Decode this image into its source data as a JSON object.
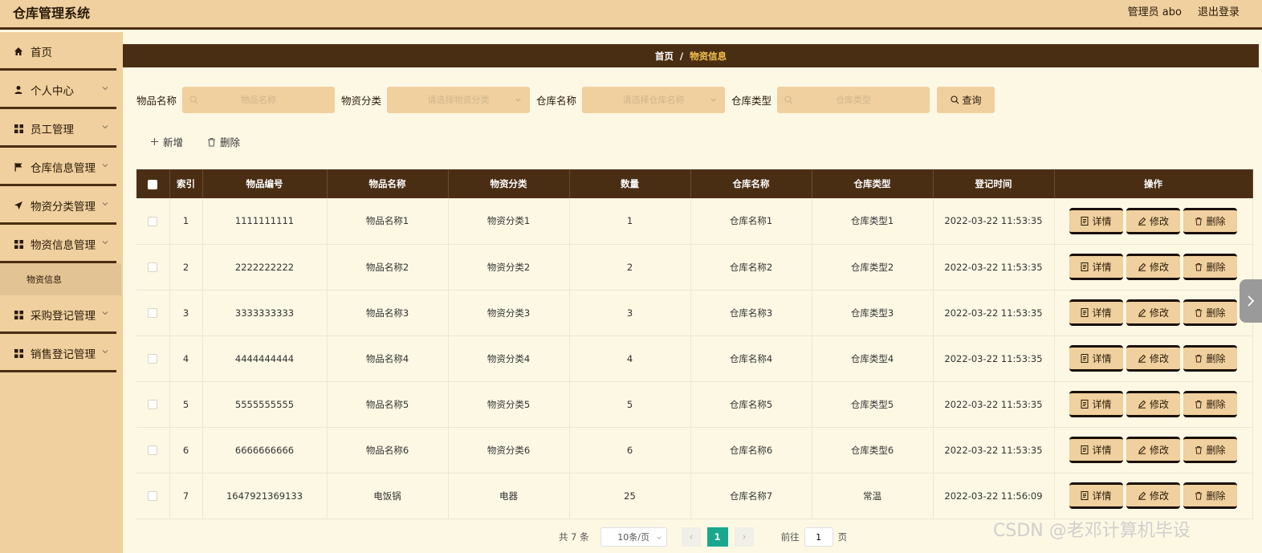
{
  "app": {
    "title": "仓库管理系统"
  },
  "header": {
    "user": "管理员 abo",
    "logout": "退出登录"
  },
  "sidebar": {
    "items": [
      {
        "label": "首页",
        "icon": "home-icon"
      },
      {
        "label": "个人中心",
        "icon": "user-icon"
      },
      {
        "label": "员工管理",
        "icon": "grid-icon"
      },
      {
        "label": "仓库信息管理",
        "icon": "flag-icon"
      },
      {
        "label": "物资分类管理",
        "icon": "send-icon"
      },
      {
        "label": "物资信息管理",
        "icon": "grid-icon"
      },
      {
        "label": "物资信息",
        "icon": ""
      },
      {
        "label": "采购登记管理",
        "icon": "grid-icon"
      },
      {
        "label": "销售登记管理",
        "icon": "grid-icon"
      }
    ]
  },
  "breadcrumb": {
    "home": "首页",
    "separator": "/",
    "current": "物资信息"
  },
  "search": {
    "f1_label": "物品名称",
    "f1_placeholder": "物品名称",
    "f2_label": "物资分类",
    "f2_placeholder": "请选择物资分类",
    "f3_label": "仓库名称",
    "f3_placeholder": "请选择仓库名称",
    "f4_label": "仓库类型",
    "f4_placeholder": "仓库类型",
    "query": "查询"
  },
  "actions": {
    "add": "新增",
    "delete": "删除"
  },
  "table": {
    "columns": [
      "索引",
      "物品编号",
      "物品名称",
      "物资分类",
      "数量",
      "仓库名称",
      "仓库类型",
      "登记时间",
      "操作"
    ],
    "rows": [
      [
        "1",
        "1111111111",
        "物品名称1",
        "物资分类1",
        "1",
        "仓库名称1",
        "仓库类型1",
        "2022-03-22 11:53:35"
      ],
      [
        "2",
        "2222222222",
        "物品名称2",
        "物资分类2",
        "2",
        "仓库名称2",
        "仓库类型2",
        "2022-03-22 11:53:35"
      ],
      [
        "3",
        "3333333333",
        "物品名称3",
        "物资分类3",
        "3",
        "仓库名称3",
        "仓库类型3",
        "2022-03-22 11:53:35"
      ],
      [
        "4",
        "4444444444",
        "物品名称4",
        "物资分类4",
        "4",
        "仓库名称4",
        "仓库类型4",
        "2022-03-22 11:53:35"
      ],
      [
        "5",
        "5555555555",
        "物品名称5",
        "物资分类5",
        "5",
        "仓库名称5",
        "仓库类型5",
        "2022-03-22 11:53:35"
      ],
      [
        "6",
        "6666666666",
        "物品名称6",
        "物资分类6",
        "6",
        "仓库名称6",
        "仓库类型6",
        "2022-03-22 11:53:35"
      ],
      [
        "7",
        "1647921369133",
        "电饭锅",
        "电器",
        "25",
        "仓库名称7",
        "常温",
        "2022-03-22 11:56:09"
      ]
    ],
    "op_detail": "详情",
    "op_edit": "修改",
    "op_delete": "删除"
  },
  "pagination": {
    "total": "共 7 条",
    "page_size": "10条/页",
    "current": "1",
    "goto": "前往",
    "goto_value": "1",
    "page_unit": "页"
  },
  "watermark": "CSDN @老邓计算机毕设",
  "colors": {
    "accent": "#efd09e",
    "dark": "#4a2e14",
    "highlight": "#f3c14d",
    "page_active": "#19a88e"
  }
}
